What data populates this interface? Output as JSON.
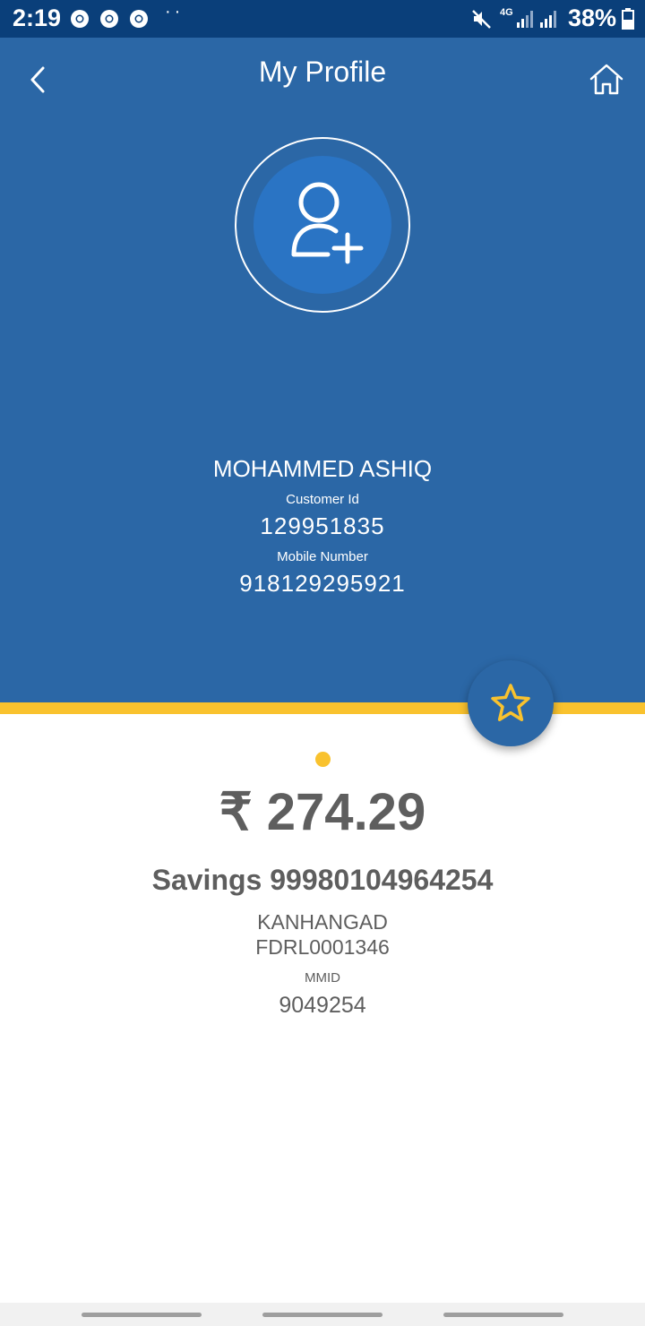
{
  "status_bar": {
    "time": "2:19",
    "overflow_dots": "··",
    "network_type": "4G",
    "battery": "38%"
  },
  "header": {
    "title": "My Profile",
    "back_icon": "chevron-left-icon",
    "home_icon": "home-icon"
  },
  "profile": {
    "avatar_icon": "add-user-icon",
    "name": "MOHAMMED ASHIQ",
    "customer_id_label": "Customer Id",
    "customer_id": "129951835",
    "mobile_label": "Mobile Number",
    "mobile_number": "918129295921"
  },
  "account": {
    "favorite_icon": "star-icon",
    "balance": "₹ 274.29",
    "account_line": "Savings 99980104964254",
    "branch": "KANHANGAD",
    "ifsc": "FDRL0001346",
    "mmid_label": "MMID",
    "mmid": "9049254"
  },
  "colors": {
    "status_bar": "#0a3f7a",
    "header_bg": "#2b67a6",
    "accent_yellow": "#f9c22e",
    "text_gray": "#5e5e5e"
  }
}
